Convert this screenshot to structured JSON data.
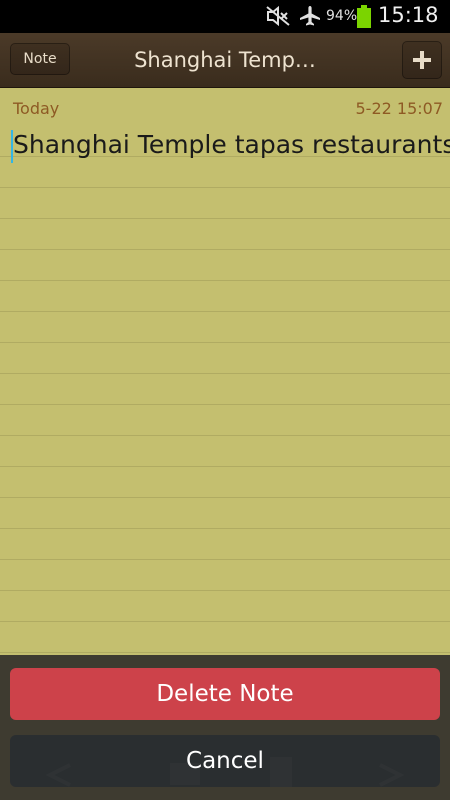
{
  "status_bar": {
    "battery_percent": "94%",
    "time": "15:18",
    "icons": [
      "mute-icon",
      "airplane-mode-icon",
      "battery-icon"
    ]
  },
  "title_bar": {
    "note_button_label": "Note",
    "title": "Shanghai Temp…",
    "add_icon": "plus-icon"
  },
  "note": {
    "date_label": "Today",
    "timestamp": "5-22 15:07",
    "body": "Shanghai Temple tapas restaurants"
  },
  "dialog": {
    "delete_label": "Delete Note",
    "cancel_label": "Cancel"
  },
  "colors": {
    "paper": "#c4bf6f",
    "date_text": "#8e5a24",
    "delete_button": "#cd424a",
    "title_bar": "#3a2c1d"
  }
}
